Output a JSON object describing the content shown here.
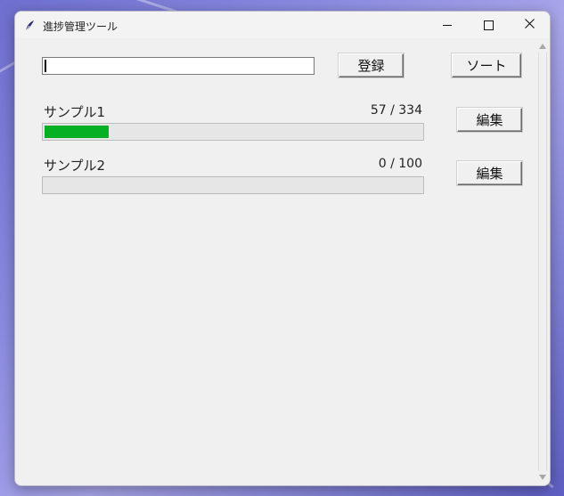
{
  "window": {
    "title": "進捗管理ツール",
    "minimize_glyph": "—",
    "maximize_glyph": "☐",
    "close_glyph": "✕"
  },
  "toolbar": {
    "entry_value": "",
    "register_label": "登録",
    "sort_label": "ソート"
  },
  "items": [
    {
      "name": "サンプル1",
      "current": 57,
      "total": 334,
      "count_text": "57 / 334",
      "progress": 0.1707,
      "edit_label": "編集"
    },
    {
      "name": "サンプル2",
      "current": 0,
      "total": 100,
      "count_text": "0 / 100",
      "progress": 0.0,
      "edit_label": "編集"
    }
  ],
  "colors": {
    "progress_fill": "#06b025",
    "window_bg": "#f0f0f0"
  },
  "icons": {
    "app": "feather-icon",
    "scroll_up": "triangle-up-icon",
    "scroll_down": "triangle-down-icon"
  }
}
